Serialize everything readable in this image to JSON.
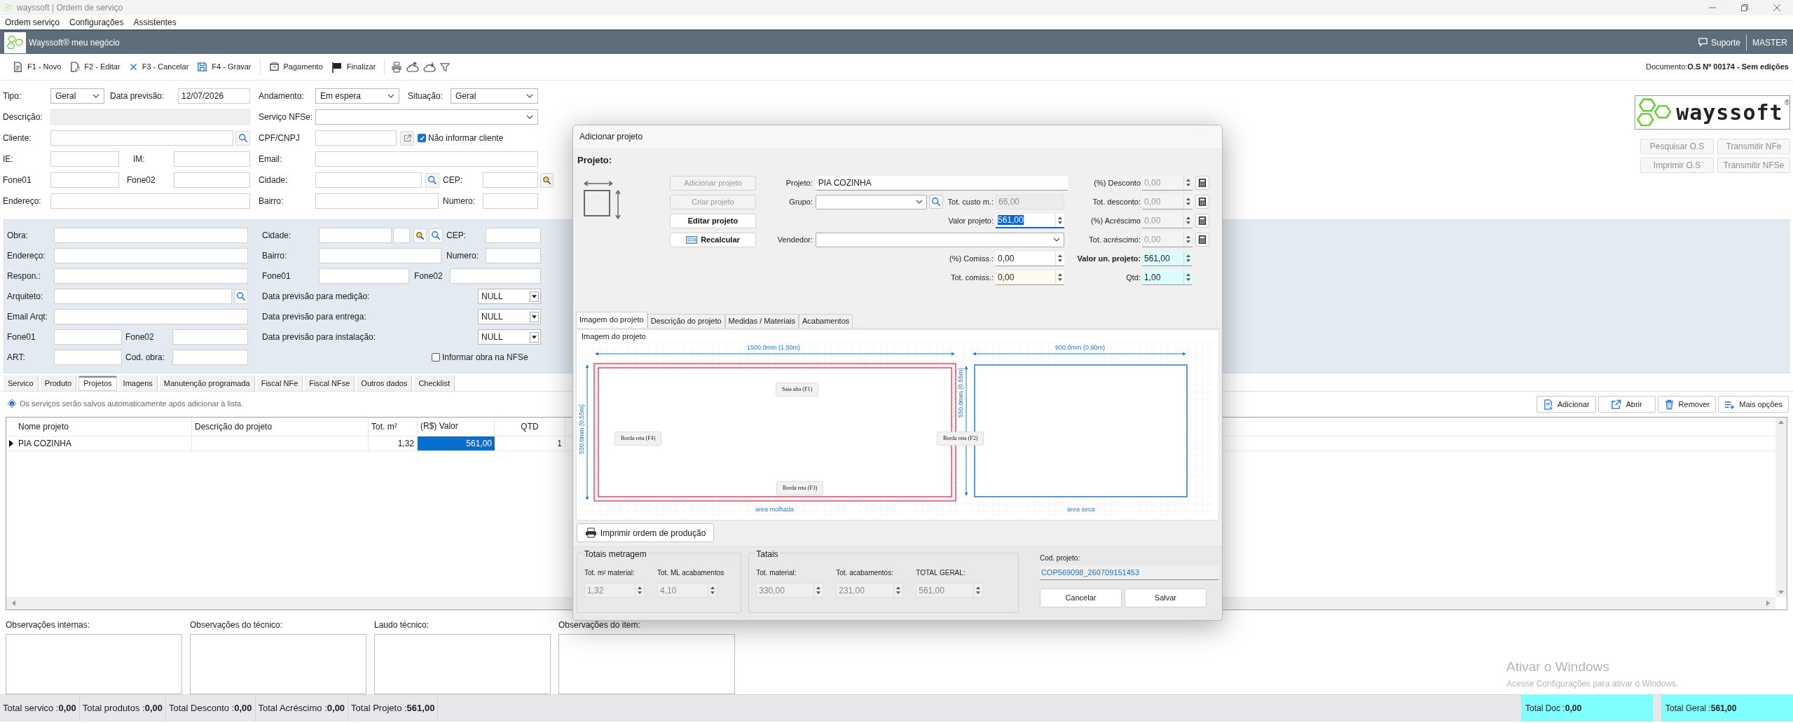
{
  "window": {
    "title": "wayssoft | Ordem de serviço"
  },
  "menu": [
    "Ordem serviço",
    "Configurações",
    "Assistentes"
  ],
  "header": {
    "brand": "Wayssoft® meu negócio",
    "support": "Suporte",
    "user": "MASTER"
  },
  "toolbar": [
    {
      "label": "F1 - Novo",
      "kind": "new"
    },
    {
      "label": "F2 - Editar",
      "kind": "edit"
    },
    {
      "label": "F3 - Cancelar",
      "kind": "cancel"
    },
    {
      "label": "F4 - Gravar",
      "kind": "save"
    },
    {
      "label": "Pagamento",
      "kind": "payment"
    },
    {
      "label": "Finalizar",
      "kind": "finish"
    }
  ],
  "document": {
    "label": "Documento:",
    "value": "O.S Nº 00174 - Sem edições"
  },
  "logo": {
    "text": "wayssoft",
    "mark": "®"
  },
  "side_buttons": [
    {
      "label": "Pesquisar O.S",
      "disabled": true
    },
    {
      "label": "Transmitir NFe",
      "disabled": true
    },
    {
      "label": "Imprimir O.S",
      "disabled": true
    },
    {
      "label": "Transmitir NFSe",
      "disabled": true
    }
  ],
  "form": {
    "lines": [
      {
        "fields": [
          {
            "kind": "label",
            "text": "Tipo:"
          },
          {
            "kind": "select",
            "value": "Geral"
          },
          {
            "kind": "label",
            "text": "Data previsão:"
          },
          {
            "kind": "input",
            "value": "12/07/2026"
          },
          {
            "kind": "label",
            "text": "Andamento:"
          },
          {
            "kind": "select",
            "value": "Em espera"
          },
          {
            "kind": "label",
            "text": "Situação:"
          },
          {
            "kind": "select",
            "value": "Geral"
          }
        ]
      },
      {
        "fields": [
          {
            "kind": "label",
            "text": "Descrição:"
          },
          {
            "kind": "readonly"
          },
          {
            "kind": "label",
            "text": "Serviço NFSe:"
          },
          {
            "kind": "select"
          }
        ]
      },
      {
        "fields": [
          {
            "kind": "label",
            "text": "Cliente:"
          },
          {
            "kind": "input"
          },
          {
            "kind": "search"
          },
          {
            "kind": "label",
            "text": "CPF/CNPJ"
          },
          {
            "kind": "input"
          },
          {
            "kind": "link"
          },
          {
            "kind": "checkbox",
            "text": "Não informar cliente",
            "checked": true
          }
        ]
      },
      {
        "fields": [
          {
            "kind": "label",
            "text": "IE:"
          },
          {
            "kind": "input"
          },
          {
            "kind": "label",
            "text": "IM:"
          },
          {
            "kind": "input"
          },
          {
            "kind": "label",
            "text": "Email:"
          },
          {
            "kind": "input"
          }
        ]
      },
      {
        "fields": [
          {
            "kind": "label",
            "text": "Fone01"
          },
          {
            "kind": "input"
          },
          {
            "kind": "label",
            "text": "Fone02"
          },
          {
            "kind": "input"
          },
          {
            "kind": "label",
            "text": "Cidade:"
          },
          {
            "kind": "input"
          },
          {
            "kind": "search"
          },
          {
            "kind": "label",
            "text": "CEP:"
          },
          {
            "kind": "input"
          },
          {
            "kind": "cep"
          }
        ]
      },
      {
        "fields": [
          {
            "kind": "label",
            "text": "Endereço:"
          },
          {
            "kind": "input"
          },
          {
            "kind": "label",
            "text": "Bairro:"
          },
          {
            "kind": "input"
          },
          {
            "kind": "label",
            "text": "Numero:"
          },
          {
            "kind": "input"
          }
        ]
      }
    ]
  },
  "work": {
    "lines": [
      {
        "fields": [
          {
            "kind": "label",
            "text": "Obra:"
          },
          {
            "kind": "input"
          },
          {
            "kind": "label",
            "text": "Cidade:"
          },
          {
            "kind": "input"
          },
          {
            "kind": "input"
          },
          {
            "kind": "cep"
          },
          {
            "kind": "search"
          },
          {
            "kind": "label",
            "text": "CEP:"
          },
          {
            "kind": "input"
          }
        ]
      },
      {
        "fields": [
          {
            "kind": "label",
            "text": "Endereço:"
          },
          {
            "kind": "input"
          },
          {
            "kind": "label",
            "text": "Bairro:"
          },
          {
            "kind": "input"
          },
          {
            "kind": "label",
            "text": "Numero:"
          },
          {
            "kind": "input"
          }
        ]
      },
      {
        "fields": [
          {
            "kind": "label",
            "text": "Respon.:"
          },
          {
            "kind": "input"
          },
          {
            "kind": "label",
            "text": "Fone01"
          },
          {
            "kind": "input"
          },
          {
            "kind": "label",
            "text": "Fone02"
          },
          {
            "kind": "input"
          }
        ]
      },
      {
        "fields": [
          {
            "kind": "label",
            "text": "Arquiteto:"
          },
          {
            "kind": "input"
          },
          {
            "kind": "search"
          },
          {
            "kind": "label",
            "text": "Data previsão para medição:"
          },
          {
            "kind": "combo",
            "value": "NULL"
          }
        ]
      },
      {
        "fields": [
          {
            "kind": "label",
            "text": "Email Arqt:"
          },
          {
            "kind": "input"
          },
          {
            "kind": "label",
            "text": "Data previsão para entrega:"
          },
          {
            "kind": "combo",
            "value": "NULL"
          }
        ]
      },
      {
        "fields": [
          {
            "kind": "label",
            "text": "Fone01"
          },
          {
            "kind": "input"
          },
          {
            "kind": "label",
            "text": "Fone02"
          },
          {
            "kind": "input"
          },
          {
            "kind": "label",
            "text": "Data previsão para instalação:"
          },
          {
            "kind": "combo",
            "value": "NULL"
          }
        ]
      },
      {
        "fields": [
          {
            "kind": "label",
            "text": "ART:"
          },
          {
            "kind": "input"
          },
          {
            "kind": "label",
            "text": "Cod. obra:"
          },
          {
            "kind": "input"
          },
          {
            "kind": "checkbox",
            "text": "Informar obra na NFSe",
            "checked": false
          }
        ]
      }
    ]
  },
  "tabs": [
    {
      "label": "Servico",
      "selected": false
    },
    {
      "label": "Produto",
      "selected": false
    },
    {
      "label": "Projetos",
      "selected": true
    },
    {
      "label": "Imagens",
      "selected": false
    },
    {
      "label": "Manutenção programada",
      "selected": false
    },
    {
      "label": "Fiscal NFe",
      "selected": false
    },
    {
      "label": "Fiscal NFse",
      "selected": false
    },
    {
      "label": "Outros dados",
      "selected": false
    },
    {
      "label": "Checklist",
      "selected": false
    }
  ],
  "info": "Os serviços serão salvos automaticamente após adicionar à lista.",
  "list_actions": [
    {
      "label": "Adicionar",
      "kind": "add"
    },
    {
      "label": "Abrir",
      "kind": "open"
    },
    {
      "label": "Remover",
      "kind": "remove"
    },
    {
      "label": "Mais opções",
      "kind": "more"
    }
  ],
  "table": {
    "columns": [
      "Nome projeto",
      "Descrição do projeto",
      "Tot. m²",
      "(R$) Valor",
      "QTD"
    ],
    "rows": [
      {
        "name": "PIA COZINHA",
        "area": "1,32",
        "value": "561,00",
        "qty": "1",
        "selected": true
      }
    ]
  },
  "notes": [
    "Observações internas:",
    "Observações do técnico:",
    "Laudo técnico:",
    "Observações do item:"
  ],
  "status_bar": [
    "Total servico :**0,00**",
    "Total produtos :**0,00**",
    "Total Desconto :**0,00**",
    "Total Acréscimo :**0,00**",
    "Total Projeto :**561,00**"
  ],
  "totals_highlight": [
    "Total Doc :**0,00**",
    "Total Geral :**561,00**"
  ],
  "activation_notice": {
    "title": "Ativar o Windows",
    "text": "Acesse Configurações para ativar o Windows."
  },
  "dialog": {
    "title": "Adicionar projeto",
    "section": "Projeto:",
    "actions": [
      {
        "label": "Adicionar projeto",
        "disabled": true,
        "kind": "plain"
      },
      {
        "label": "Criar projeto",
        "disabled": true,
        "kind": "plain"
      },
      {
        "label": "Editar projeto",
        "disabled": false,
        "kind": "plain"
      },
      {
        "label": "Recalcular",
        "disabled": false,
        "kind": "calc"
      }
    ],
    "project": {
      "label": "Projeto:",
      "value": "PIA COZINHA"
    },
    "group": {
      "label": "Grupo:"
    },
    "cost": {
      "label": "Tot. custo m.:",
      "value": "66,00"
    },
    "project_value": {
      "label": "Valor projeto:",
      "value": "561,00"
    },
    "seller": {
      "label": "Vendedor:"
    },
    "commission_pct": {
      "label": "(%) Comiss.:",
      "value": "0,00"
    },
    "commission_total": {
      "label": "Tot. comiss.:",
      "value": "0,00"
    },
    "adjustments": [
      {
        "label": "(%) Desconto",
        "value": "0,00",
        "disabled": true
      },
      {
        "label": "Tot. desconto:",
        "value": "0,00",
        "disabled": true
      },
      {
        "label": "(%) Acréscimo",
        "value": "0,00",
        "disabled": true
      },
      {
        "label": "Tot. acréscimo:",
        "value": "0,00",
        "disabled": true
      }
    ],
    "unit_value": {
      "label": "Valor un. projeto:",
      "value": "561,00"
    },
    "quantity": {
      "label": "Qtd:",
      "value": "1,00"
    },
    "tabs": [
      {
        "label": "Imagem do projeto",
        "selected": true
      },
      {
        "label": "Descrição do projeto",
        "selected": false
      },
      {
        "label": "Medidas / Materiais",
        "selected": false
      },
      {
        "label": "Acabamentos",
        "selected": false
      }
    ],
    "image_group": "Imagem do projeto",
    "drawing": {
      "width_main": "1500.0mm (1.50m)",
      "width_side": "900.0mm (0.90m)",
      "depth_main": "550.0mm (0.55m)",
      "depth_side": "550.0mm (0.55m)",
      "edges": [
        "Saia alta (F1)",
        "Borda reta (F4)",
        "Borda reta (F2)",
        "Borda reta (F3)"
      ],
      "areas": [
        "area molhada",
        "area seca"
      ]
    },
    "print_button": "Imprimir ordem de produção",
    "metragem": {
      "title": "Totais metragem",
      "items": [
        {
          "label": "Tot. m² material:",
          "value": "1,32"
        },
        {
          "label": "Tot. ML acabamentos",
          "value": "4,10"
        }
      ]
    },
    "totals": {
      "title": "Tatais",
      "items": [
        {
          "label": "Tot. material:",
          "value": "330,00"
        },
        {
          "label": "Tot. acabamentos:",
          "value": "231,00"
        },
        {
          "label": "TOTAL GERAL:",
          "value": "561,00"
        }
      ]
    },
    "code": {
      "label": "Cod. projeto:",
      "value": "COP569098_260709151453"
    },
    "buttons": [
      "Cancelar",
      "Salvar"
    ]
  }
}
